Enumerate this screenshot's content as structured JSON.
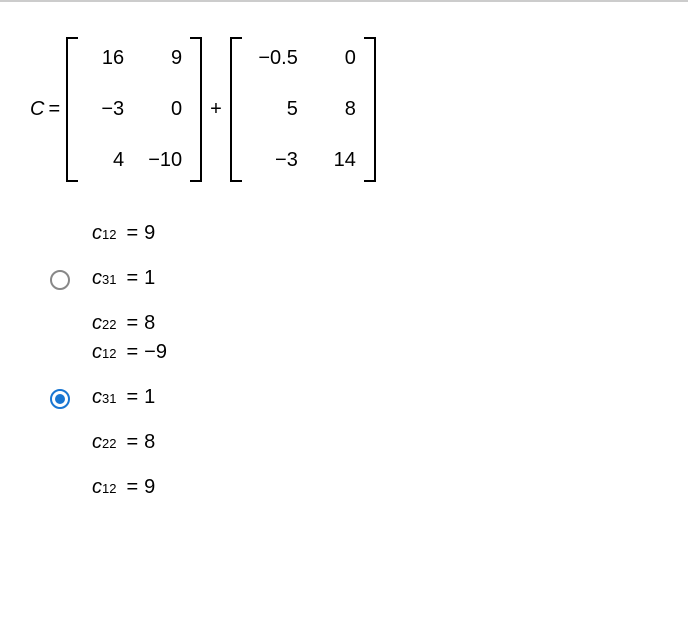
{
  "equation": {
    "variable": "C",
    "equals": "=",
    "coefficient": "-",
    "operator": "+",
    "matrix1": {
      "r1c1": "16",
      "r1c2": "9",
      "r2c1": "−3",
      "r2c2": "0",
      "r3c1": "4",
      "r3c2": "−10"
    },
    "matrix2": {
      "r1c1": "−0.5",
      "r1c2": "0",
      "r2c1": "5",
      "r2c2": "8",
      "r3c1": "−3",
      "r3c2": "14"
    }
  },
  "options": {
    "opt1": {
      "selected": false,
      "l1": {
        "var": "c",
        "sub": "12",
        "val": "9"
      },
      "l2": {
        "var": "c",
        "sub": "31",
        "val": "1"
      },
      "l3": {
        "var": "c",
        "sub": "22",
        "val": "8"
      }
    },
    "opt2": {
      "selected": true,
      "l1": {
        "var": "c",
        "sub": "12",
        "val": "−9"
      },
      "l2": {
        "var": "c",
        "sub": "31",
        "val": "1"
      },
      "l3": {
        "var": "c",
        "sub": "22",
        "val": "8"
      },
      "l4": {
        "var": "c",
        "sub": "12",
        "val": "9"
      }
    }
  },
  "eq_sign": "="
}
